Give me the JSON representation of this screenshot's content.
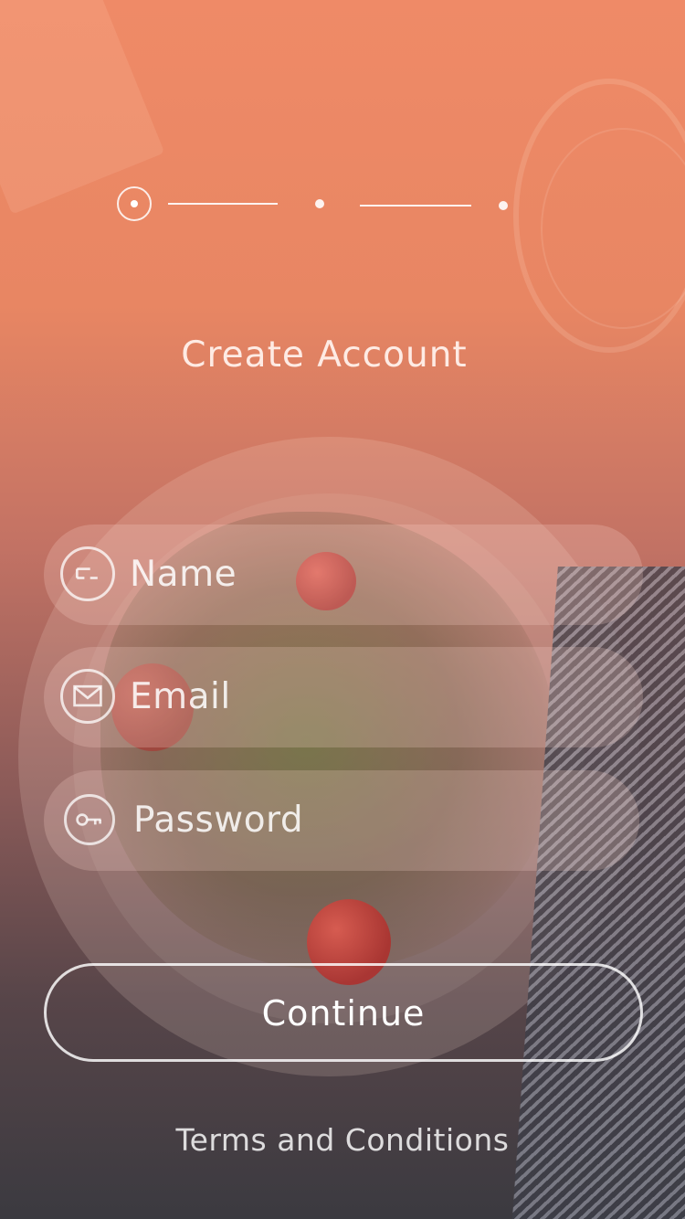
{
  "colors": {
    "gradient_top": "#ef8a67",
    "gradient_bottom": "#3b3a40",
    "text": "#ffffff"
  },
  "stepper": {
    "total_steps": 3,
    "current_step": 1
  },
  "header": {
    "title": "Create Account"
  },
  "form": {
    "fields": [
      {
        "label": "Name",
        "icon": "person-card-icon"
      },
      {
        "label": "Email",
        "icon": "envelope-icon"
      },
      {
        "label": "Password",
        "icon": "key-icon"
      }
    ],
    "submit_label": "Continue"
  },
  "footer": {
    "terms_label": "Terms and Conditions"
  }
}
